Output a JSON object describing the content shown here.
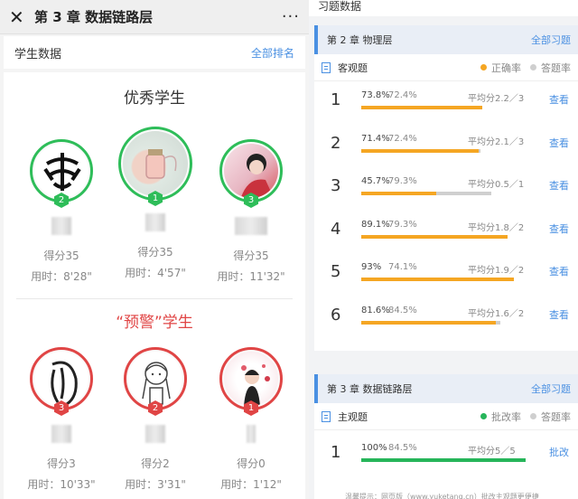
{
  "left": {
    "header_title": "第 3 章 数据链路层",
    "close_glyph": "✕",
    "more_glyph": "···",
    "sub_label": "学生数据",
    "rank_link": "全部排名",
    "excellent_title": "优秀学生",
    "warning_title": "“预警”学生",
    "excellent": [
      {
        "rank": "2",
        "score": "得分35",
        "time": "用时：8'28\""
      },
      {
        "rank": "1",
        "score": "得分35",
        "time": "用时：4'57\""
      },
      {
        "rank": "3",
        "score": "得分35",
        "time": "用时：11'32\""
      }
    ],
    "warning": [
      {
        "rank": "3",
        "score": "得分3",
        "time": "用时：10'33\""
      },
      {
        "rank": "2",
        "score": "得分2",
        "time": "用时：3'31\""
      },
      {
        "rank": "1",
        "score": "得分0",
        "time": "用时：1'12\""
      }
    ]
  },
  "right": {
    "header": "习题数据",
    "chapter1": {
      "title": "第 2 章 物理层",
      "link": "全部习题",
      "type_label": "客观题",
      "legend_a": "正确率",
      "legend_b": "答题率",
      "questions": [
        {
          "num": "1",
          "correct": "73.8%",
          "answered": "72.4%",
          "avg": "平均分2.2／3",
          "view": "查看",
          "correct_frac": 0.738,
          "answered_frac": 0.724
        },
        {
          "num": "2",
          "correct": "71.4%",
          "answered": "72.4%",
          "avg": "平均分2.1／3",
          "view": "查看",
          "correct_frac": 0.714,
          "answered_frac": 0.724
        },
        {
          "num": "3",
          "correct": "45.7%",
          "answered": "79.3%",
          "avg": "平均分0.5／1",
          "view": "查看",
          "correct_frac": 0.457,
          "answered_frac": 0.793
        },
        {
          "num": "4",
          "correct": "89.1%",
          "answered": "79.3%",
          "avg": "平均分1.8／2",
          "view": "查看",
          "correct_frac": 0.891,
          "answered_frac": 0.793
        },
        {
          "num": "5",
          "correct": "93%",
          "answered": "74.1%",
          "avg": "平均分1.9／2",
          "view": "查看",
          "correct_frac": 0.93,
          "answered_frac": 0.741
        },
        {
          "num": "6",
          "correct": "81.6%",
          "answered": "84.5%",
          "avg": "平均分1.6／2",
          "view": "查看",
          "correct_frac": 0.816,
          "answered_frac": 0.845
        }
      ]
    },
    "chapter2": {
      "title": "第 3 章 数据链路层",
      "link": "全部习题",
      "type_label": "主观题",
      "legend_a": "批改率",
      "legend_b": "答题率",
      "questions": [
        {
          "num": "1",
          "correct": "100%",
          "answered": "84.5%",
          "avg": "平均分5／5",
          "view": "批改",
          "correct_frac": 1.0,
          "answered_frac": 0.845
        }
      ],
      "tip": "温馨提示：网页版（www.yuketang.cn）批改主观题更便捷"
    },
    "colors": {
      "correct": "#f5a623",
      "answered": "#cfcfcf",
      "graded": "#26b55a",
      "accent": "#4a90e2"
    }
  }
}
